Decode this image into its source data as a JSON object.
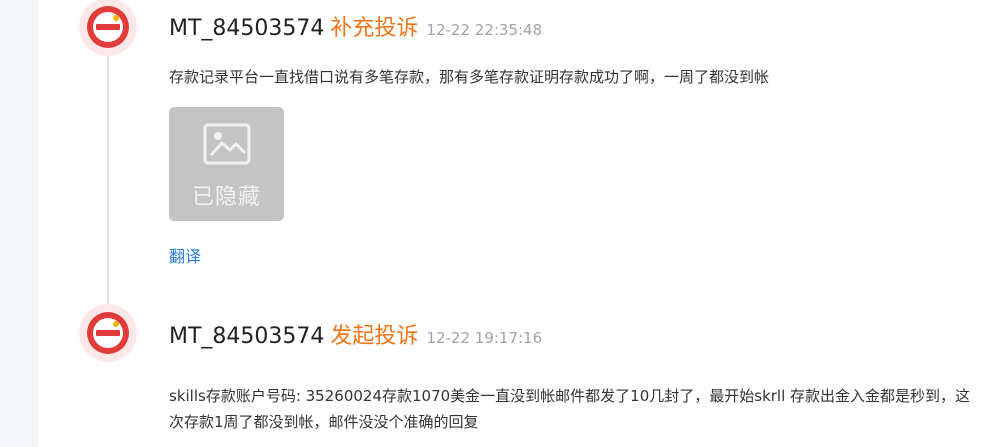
{
  "entries": [
    {
      "user": "MT_84503574",
      "action": "补充投诉",
      "time": "12-22 22:35:48",
      "text": "存款记录平台一直找借口说有多笔存款，那有多笔存款证明存款成功了啊，一周了都没到帐",
      "image": {
        "label": "已隐藏",
        "icon": "image-icon"
      },
      "translate_label": "翻译"
    },
    {
      "user": "MT_84503574",
      "action": "发起投诉",
      "time": "12-22 19:17:16",
      "text": "skills存款账户号码: 35260024存款1070美金一直没到帐邮件都发了10几封了，最开始skrll 存款出金入金都是秒到，这次存款1周了都没到帐，邮件没没个准确的回复"
    }
  ],
  "colors": {
    "action": "#f27418",
    "link": "#2b78d6",
    "timestamp": "#a3a3a3",
    "avatar_red": "#e23b3b",
    "avatar_bg": "#fde8e8"
  }
}
